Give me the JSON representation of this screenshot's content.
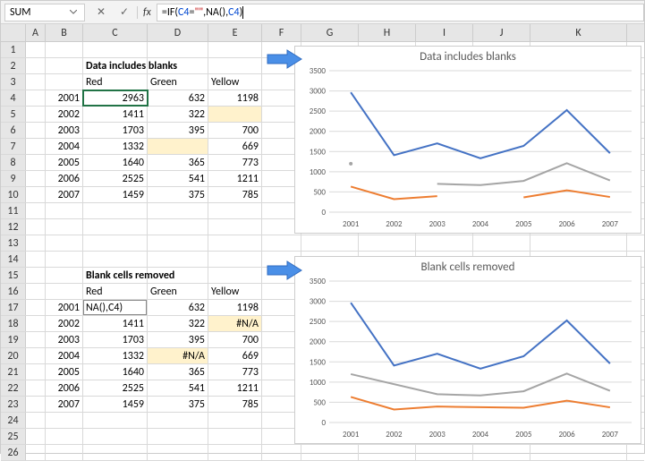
{
  "name_box": "SUM",
  "formula_parts": {
    "p1": "=IF(",
    "p2": "C4",
    "p3": "=",
    "p4": "\"\"",
    "p5": ",",
    "p6": "NA()",
    "p7": ",",
    "p8": "C4",
    "p9": ")"
  },
  "headers": {
    "title1": "Data includes blanks",
    "title2": "Blank cells removed",
    "red": "Red",
    "green": "Green",
    "yellow": "Yellow"
  },
  "years": [
    "2001",
    "2002",
    "2003",
    "2004",
    "2005",
    "2006",
    "2007"
  ],
  "table1": {
    "red": [
      "2963",
      "1411",
      "1703",
      "1332",
      "1640",
      "2525",
      "1459"
    ],
    "green": [
      "632",
      "322",
      "395",
      "",
      "365",
      "541",
      "375"
    ],
    "yellow": [
      "1198",
      "",
      "700",
      "669",
      "773",
      "1211",
      "785"
    ],
    "green_blank": [
      false,
      false,
      false,
      true,
      false,
      false,
      false
    ],
    "yellow_blank": [
      false,
      true,
      false,
      false,
      false,
      false,
      false
    ]
  },
  "table2": {
    "red_c17": "NA(),C4)",
    "red": [
      "",
      "1411",
      "1703",
      "1332",
      "1640",
      "2525",
      "1459"
    ],
    "green": [
      "632",
      "322",
      "395",
      "#N/A",
      "365",
      "541",
      "375"
    ],
    "yellow": [
      "1198",
      "#N/A",
      "700",
      "669",
      "773",
      "1211",
      "785"
    ],
    "green_hl": [
      false,
      false,
      false,
      true,
      false,
      false,
      false
    ],
    "yellow_hl": [
      false,
      true,
      false,
      false,
      false,
      false,
      false
    ]
  },
  "chart_data": [
    {
      "type": "line",
      "title": "Data includes blanks",
      "categories": [
        "2001",
        "2002",
        "2003",
        "2004",
        "2005",
        "2006",
        "2007"
      ],
      "ylim": [
        0,
        3500
      ],
      "yticks": [
        0,
        500,
        1000,
        1500,
        2000,
        2500,
        3000,
        3500
      ],
      "series": [
        {
          "name": "Red",
          "color": "#4472C4",
          "values": [
            2963,
            1411,
            1703,
            1332,
            1640,
            2525,
            1459
          ]
        },
        {
          "name": "Green",
          "color": "#ED7D31",
          "values": [
            632,
            322,
            395,
            null,
            365,
            541,
            375
          ]
        },
        {
          "name": "Yellow",
          "color": "#A5A5A5",
          "values": [
            1198,
            null,
            700,
            669,
            773,
            1211,
            785
          ]
        }
      ]
    },
    {
      "type": "line",
      "title": "Blank cells removed",
      "categories": [
        "2001",
        "2002",
        "2003",
        "2004",
        "2005",
        "2006",
        "2007"
      ],
      "ylim": [
        0,
        3500
      ],
      "yticks": [
        0,
        500,
        1000,
        1500,
        2000,
        2500,
        3000,
        3500
      ],
      "series": [
        {
          "name": "Red",
          "color": "#4472C4",
          "values": [
            2963,
            1411,
            1703,
            1332,
            1640,
            2525,
            1459
          ]
        },
        {
          "name": "Green",
          "color": "#ED7D31",
          "values": [
            632,
            322,
            395,
            null,
            365,
            541,
            375
          ]
        },
        {
          "name": "Yellow",
          "color": "#A5A5A5",
          "values": [
            1198,
            null,
            700,
            669,
            773,
            1211,
            785
          ]
        }
      ],
      "connect_nulls": true
    }
  ],
  "colnames": [
    "A",
    "B",
    "C",
    "D",
    "E",
    "F",
    "G",
    "H",
    "I",
    "J",
    "K"
  ]
}
